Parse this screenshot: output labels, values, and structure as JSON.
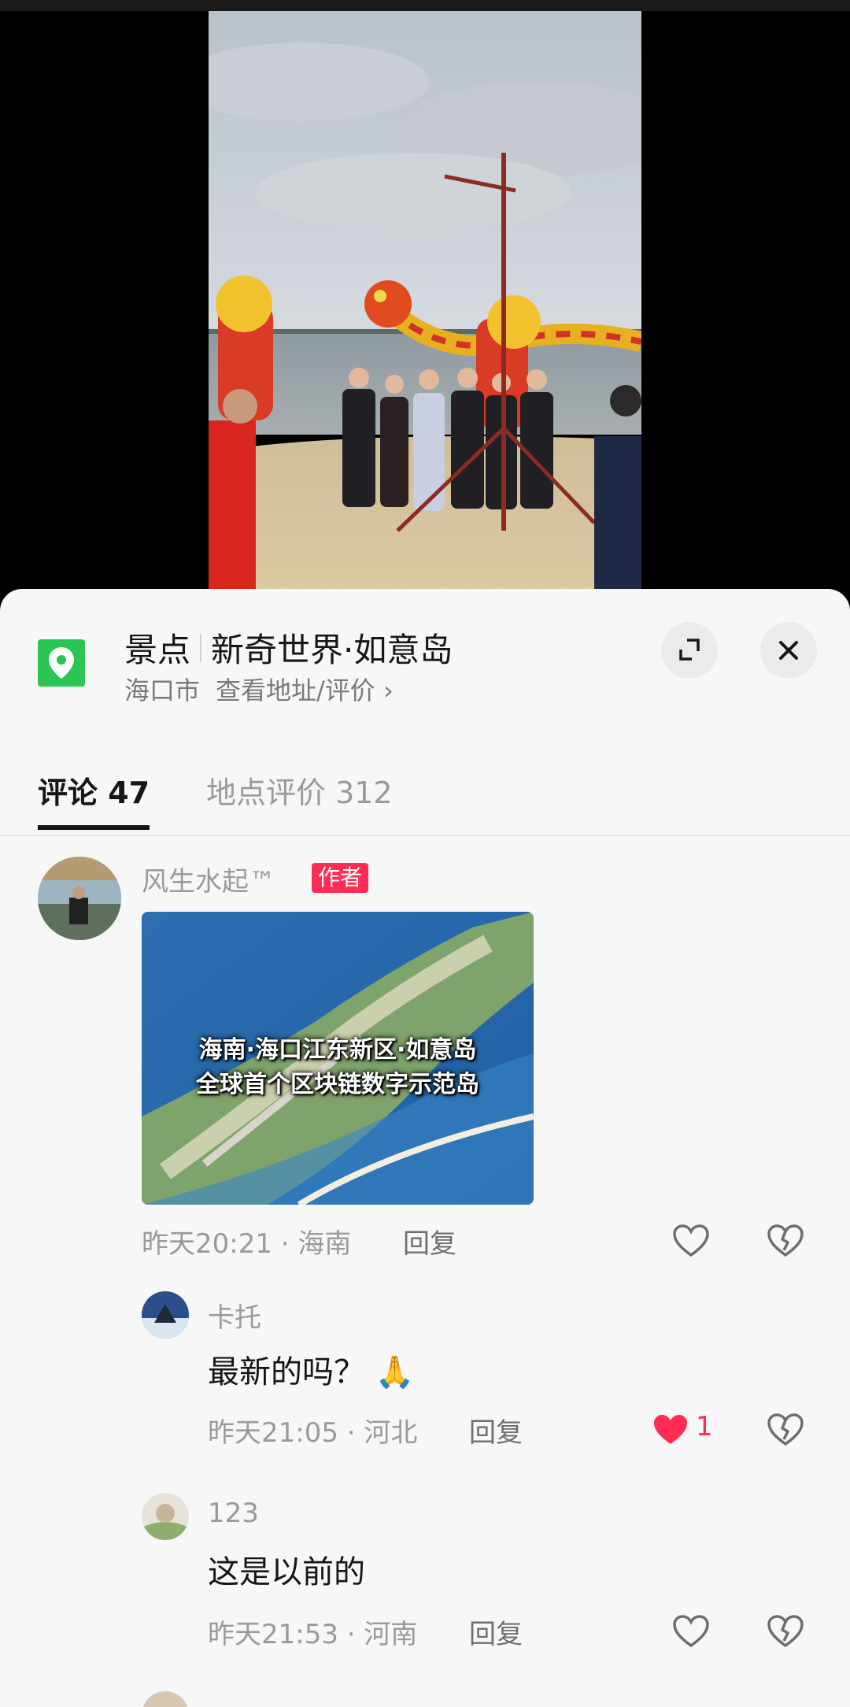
{
  "place": {
    "category": "景点",
    "name": "新奇世界·如意岛",
    "city": "海口市",
    "link": "查看地址/评价 ›",
    "brand_color": "#2bc553"
  },
  "tabs": [
    {
      "label": "评论 47",
      "active": true
    },
    {
      "label": "地点评价 312",
      "active": false
    }
  ],
  "comments": [
    {
      "user": "风生水起™",
      "badge": "作者",
      "image_caption_1": "海南·海口江东新区·如意岛",
      "image_caption_2": "全球首个区块链数字示范岛",
      "meta": "昨天20:21 · 海南",
      "reply": "回复"
    },
    {
      "user": "卡托",
      "text": "最新的吗？",
      "emoji": "🙏",
      "meta": "昨天21:05 · 河北",
      "reply": "回复",
      "likes": "1"
    },
    {
      "user": "123",
      "text": "这是以前的",
      "meta": "昨天21:53 · 河南",
      "reply": "回复"
    }
  ],
  "colors": {
    "accent": "#ff2c55",
    "text": "#161616",
    "muted": "#9a9a9a"
  }
}
